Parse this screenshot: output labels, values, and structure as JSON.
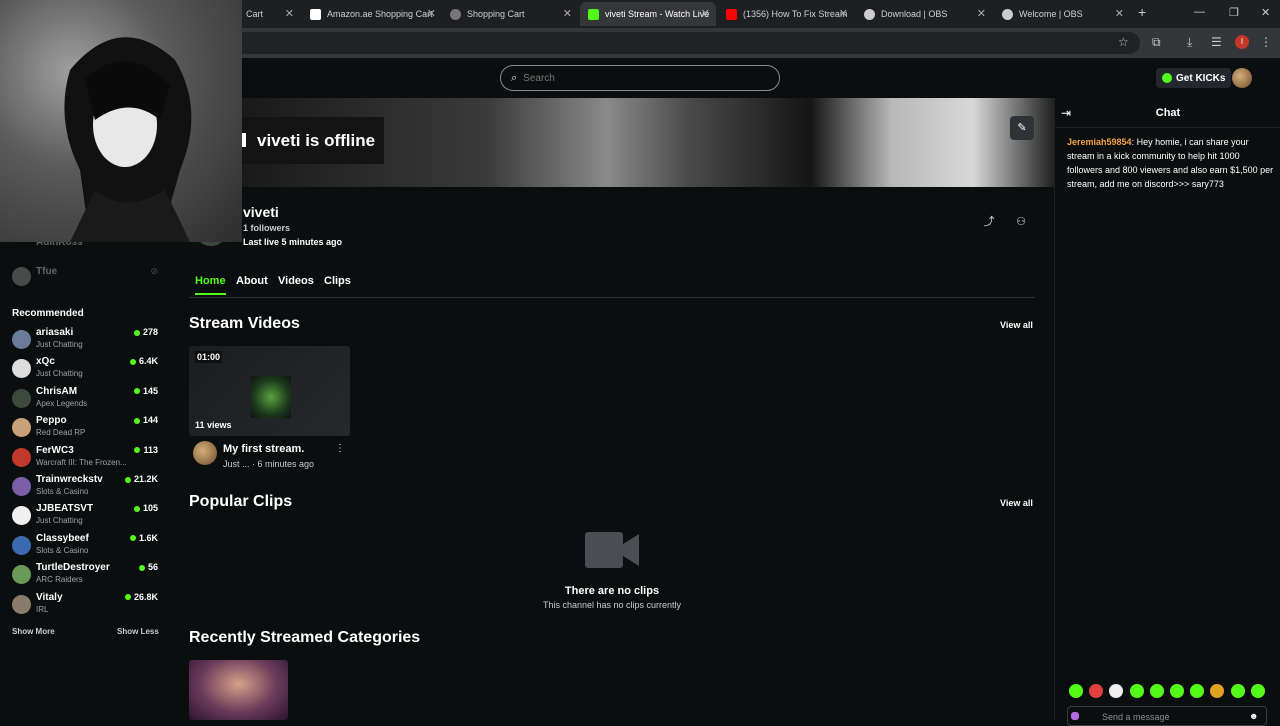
{
  "browser": {
    "tabs": [
      {
        "label": "Cart",
        "color": "#888888"
      },
      {
        "label": "Amazon.ae Shopping Cart",
        "color": "#ffffff"
      },
      {
        "label": "Shopping Cart",
        "color": "#aaaaaa"
      },
      {
        "label": "viveti Stream - Watch Live",
        "color": "#53fc18"
      },
      {
        "label": "(1356) How To Fix Stream",
        "color": "#ff0000"
      },
      {
        "label": "Download | OBS",
        "color": "#cccccc"
      },
      {
        "label": "Welcome | OBS",
        "color": "#cccccc"
      }
    ],
    "new_tab": "+",
    "profile_initial": "I"
  },
  "topnav": {
    "search_placeholder": "Search",
    "get_kicks_label": "Get KICKs"
  },
  "sidebar": {
    "following": [
      {
        "name": "AdinRoss"
      },
      {
        "name": "Tfue"
      }
    ],
    "recommended_title": "Recommended",
    "recommended": [
      {
        "name": "ariasaki",
        "category": "Just Chatting",
        "viewers": "278",
        "color": "#6a7b9a"
      },
      {
        "name": "xQc",
        "category": "Just Chatting",
        "viewers": "6.4K",
        "color": "#dddddd"
      },
      {
        "name": "ChrisAM",
        "category": "Apex Legends",
        "viewers": "145",
        "color": "#3c4a3c"
      },
      {
        "name": "Peppo",
        "category": "Red Dead RP",
        "viewers": "144",
        "color": "#c9a27a"
      },
      {
        "name": "FerWC3",
        "category": "Warcraft III: The Frozen...",
        "viewers": "113",
        "color": "#c0392b"
      },
      {
        "name": "Trainwreckstv",
        "category": "Slots & Casino",
        "viewers": "21.2K",
        "color": "#7b5ea7"
      },
      {
        "name": "JJBEATSVT",
        "category": "Just Chatting",
        "viewers": "105",
        "color": "#f0f0f0"
      },
      {
        "name": "Classybeef",
        "category": "Slots & Casino",
        "viewers": "1.6K",
        "color": "#3a6ab0"
      },
      {
        "name": "TurtleDestroyer",
        "category": "ARC Raiders",
        "viewers": "56",
        "color": "#6a9a5a"
      },
      {
        "name": "Vitaly",
        "category": "IRL",
        "viewers": "26.8K",
        "color": "#8a7a6a"
      }
    ],
    "show_more": "Show More",
    "show_less": "Show Less"
  },
  "channel": {
    "offline_label": "viveti is offline",
    "name": "viveti",
    "followers": "1 followers",
    "last_live": "Last live 5 minutes ago",
    "tabs": [
      "Home",
      "About",
      "Videos",
      "Clips"
    ]
  },
  "stream_videos": {
    "title": "Stream Videos",
    "view_all": "View all",
    "video": {
      "duration": "01:00",
      "views": "11 views",
      "title": "My first stream.",
      "category": "Just ...",
      "time": "· 6 minutes ago"
    }
  },
  "popular_clips": {
    "title": "Popular Clips",
    "view_all": "View all",
    "empty_title": "There are no clips",
    "empty_sub": "This channel has no clips currently"
  },
  "recent_categories": {
    "title": "Recently Streamed Categories"
  },
  "chat": {
    "title": "Chat",
    "message_user": "Jeremiah59854",
    "message_text": ": Hey homie, i can share your stream in a kick community to help hit 1000 followers and 800 viewers and also earn $1,500 per stream, add me on discord>>> sary773",
    "input_placeholder": "Send a message",
    "emote_colors": [
      "#53fc18",
      "#e04040",
      "#eeeeee",
      "#53fc18",
      "#53fc18",
      "#53fc18",
      "#53fc18",
      "#e0a020",
      "#53fc18",
      "#53fc18"
    ]
  },
  "colors": {
    "accent": "#53fc18",
    "background": "#0b0e0f",
    "chat_username": "#f5a04b"
  }
}
